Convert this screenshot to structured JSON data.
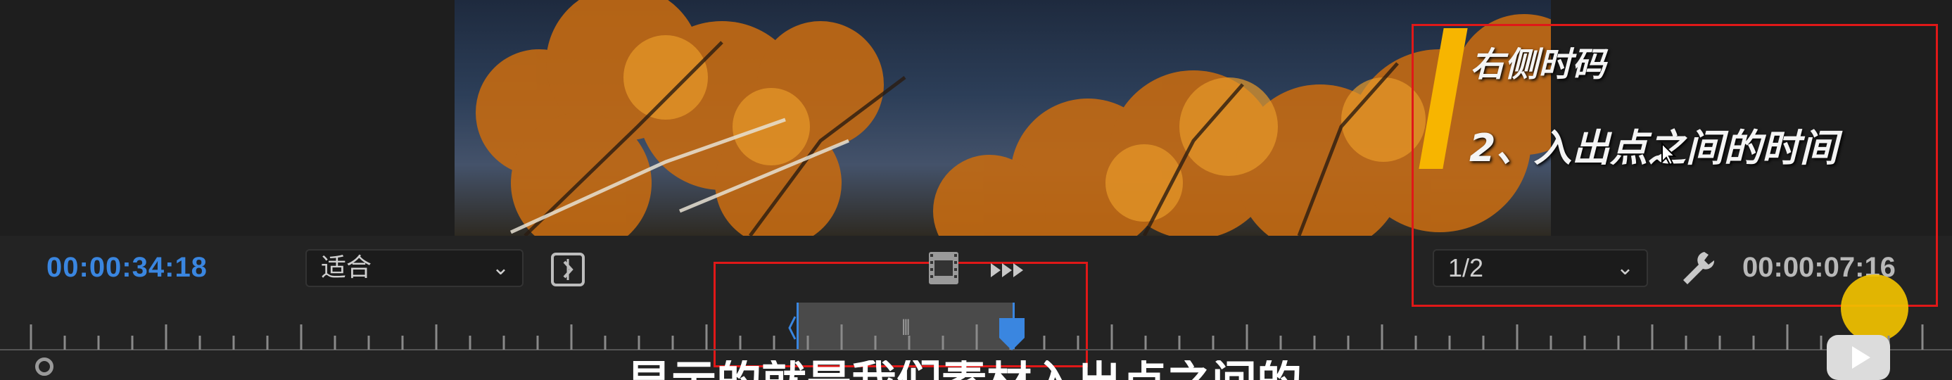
{
  "monitor": {
    "overlay_title": "右侧时码",
    "overlay_item": "2、入出点之间的时间",
    "playhead_timecode": "00:00:34:18",
    "fit_select": {
      "selected": "适合"
    },
    "resolution_select": {
      "selected": "1/2"
    },
    "duration_timecode": "00:00:07:16"
  },
  "caption": {
    "text": "显示的就是我们素材入出点之间的"
  },
  "icons": {
    "mark": "insert-frame-icon",
    "film": "film-strip-icon",
    "export": "export-frame-icon",
    "settings": "wrench-icon",
    "bilibili": "bilibili-play-icon"
  },
  "colors": {
    "timecode_accent": "#3a86e0",
    "annotation_red": "#e01818",
    "highlight_yellow": "#f7b500"
  }
}
